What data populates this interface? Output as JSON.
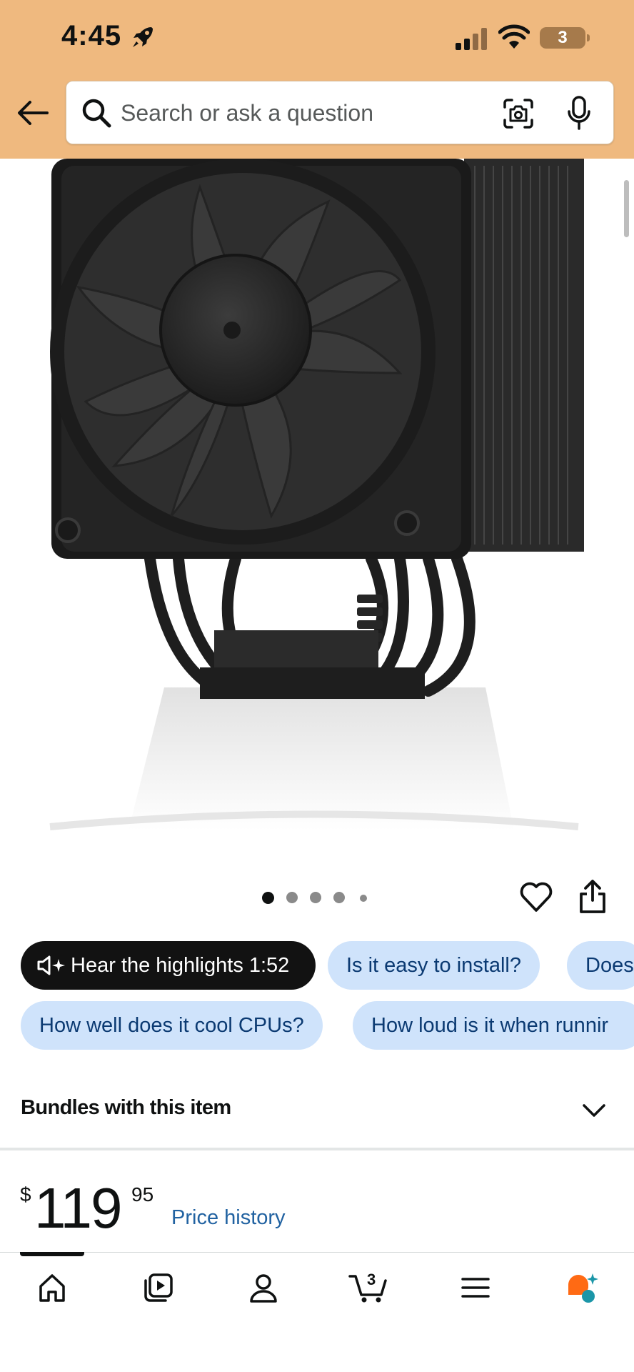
{
  "status_bar": {
    "time": "4:45",
    "battery_level": "3"
  },
  "search": {
    "placeholder": "Search or ask a question",
    "value": ""
  },
  "carousel": {
    "total_images": 5,
    "active_index": 0
  },
  "chips": {
    "row1": [
      {
        "label": "Hear the highlights 1:52"
      },
      {
        "label": "Is it easy to install?"
      },
      {
        "label": "Does"
      }
    ],
    "row2": [
      {
        "label": "How well does it cool CPUs?"
      },
      {
        "label": "How loud is it when runnir"
      }
    ]
  },
  "bundles": {
    "title": "Bundles with this item"
  },
  "price": {
    "symbol": "$",
    "whole": "119",
    "fraction": "95",
    "history_label": "Price history"
  },
  "bottom_nav": {
    "items": [
      "home-icon",
      "play-icon",
      "account-icon",
      "cart-icon",
      "menu-icon",
      "rufus-icon"
    ],
    "cart_count": "3"
  },
  "colors": {
    "header_bg": "#efb97f",
    "chip_bg": "#cfe3fb",
    "chip_text": "#0b3a72",
    "link": "#2162a1",
    "rufus_orange": "#ff6a14",
    "rufus_teal": "#1b96a8"
  }
}
